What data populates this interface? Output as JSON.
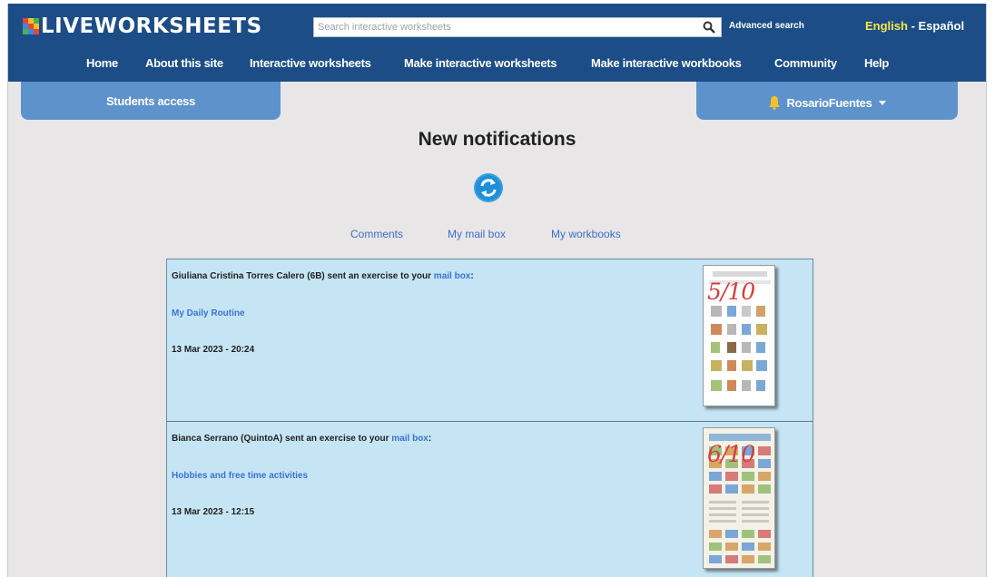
{
  "header": {
    "logo_text": "LIVEWORKSHEETS",
    "search_placeholder": "Search interactive worksheets",
    "advanced_search": "Advanced search",
    "lang_english": "English",
    "lang_sep": " - ",
    "lang_spanish": "Español",
    "colors": {
      "bar": "#1c4d86",
      "active_lang": "#f6e84a"
    }
  },
  "nav": {
    "items": [
      {
        "label": "Home"
      },
      {
        "label": "About this site"
      },
      {
        "label": "Interactive worksheets"
      },
      {
        "label": "Make interactive worksheets"
      },
      {
        "label": "Make interactive workbooks"
      },
      {
        "label": "Community"
      },
      {
        "label": "Help"
      }
    ]
  },
  "tabs": {
    "students_access": "Students access",
    "user_name": "RosarioFuentes"
  },
  "page": {
    "title": "New notifications",
    "refresh_icon": "refresh-icon",
    "sections": [
      "Comments",
      "My mail box",
      "My workbooks"
    ]
  },
  "notifications": [
    {
      "sender_text": "Giuliana Cristina Torres Calero (6B) sent an exercise to your ",
      "mailbox_link": "mail box",
      "suffix": ":",
      "worksheet": "My Daily Routine",
      "date": "13 Mar 2023 - 20:24",
      "grade": "5/10"
    },
    {
      "sender_text": "Bianca Serrano (QuintoA) sent an exercise to your ",
      "mailbox_link": "mail box",
      "suffix": ":",
      "worksheet": "Hobbies and free time activities",
      "date": "13 Mar 2023 - 12:15",
      "grade": "6/10"
    }
  ]
}
